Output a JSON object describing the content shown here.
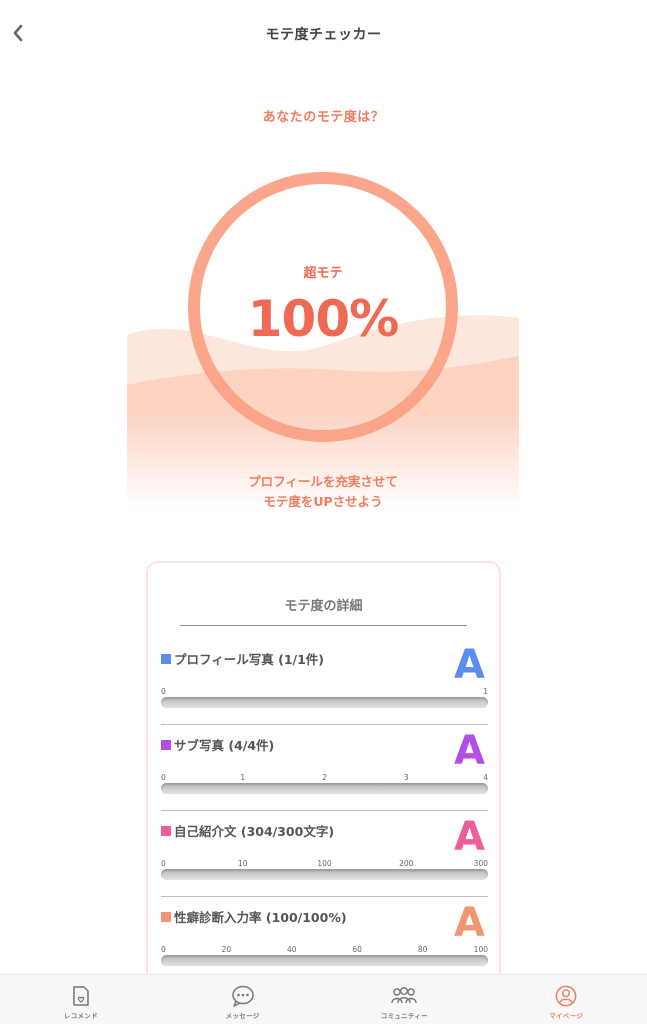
{
  "header": {
    "title": "モテ度チェッカー",
    "back_icon": "chevron-left-icon"
  },
  "score": {
    "question": "あなたのモテ度は？",
    "rank_label": "超モテ",
    "percent_text": "100%",
    "percent_value": 100,
    "message_line1": "プロフィールを充実させて",
    "message_line2": "モテ度をUPさせよう",
    "ring_color": "#fba184",
    "text_color": "#ef6a55"
  },
  "details": {
    "title": "モテ度の詳細",
    "items": [
      {
        "label": "プロフィール写真 (1/1件)",
        "color": "#5b8def",
        "grade": "A",
        "ticks": [
          "0",
          "1"
        ],
        "value": 1,
        "max": 1
      },
      {
        "label": "サブ写真 (4/4件)",
        "color": "#b44ee8",
        "grade": "A",
        "ticks": [
          "0",
          "1",
          "2",
          "3",
          "4"
        ],
        "value": 4,
        "max": 4
      },
      {
        "label": "自己紹介文 (304/300文字)",
        "color": "#ee5f99",
        "grade": "A",
        "ticks": [
          "0",
          "10",
          "100",
          "200",
          "300"
        ],
        "value": 304,
        "max": 300
      },
      {
        "label": "性癖診断入力率 (100/100%)",
        "color": "#f29570",
        "grade": "A",
        "ticks": [
          "0",
          "20",
          "40",
          "60",
          "80",
          "100"
        ],
        "value": 100,
        "max": 100
      }
    ]
  },
  "tabbar": {
    "active_color": "#f07c5e",
    "tabs": [
      {
        "label": "レコメンド",
        "icon": "recommend-card-icon",
        "active": false
      },
      {
        "label": "メッセージ",
        "icon": "message-bubble-icon",
        "active": false
      },
      {
        "label": "コミュニティー",
        "icon": "community-people-icon",
        "active": false
      },
      {
        "label": "マイページ",
        "icon": "user-profile-icon",
        "active": true
      }
    ]
  }
}
